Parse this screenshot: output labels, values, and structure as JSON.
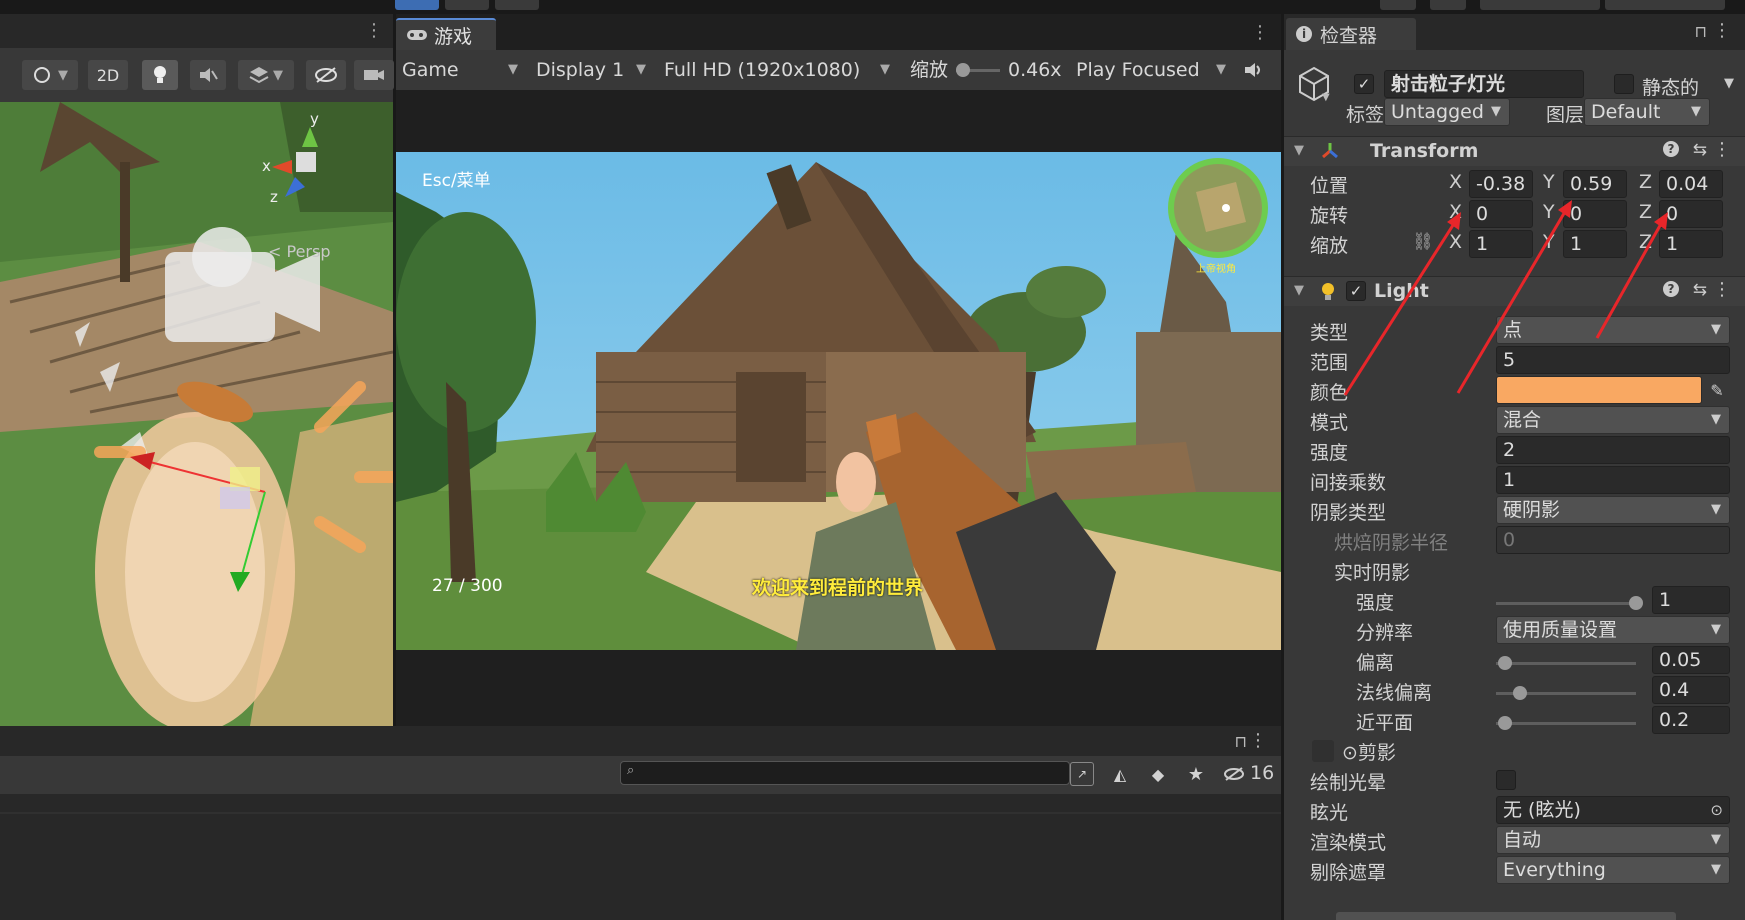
{
  "game_panel": {
    "tab_label": "游戏",
    "mode": "Game",
    "display": "Display 1",
    "resolution": "Full HD (1920x1080)",
    "scale_label": "缩放",
    "scale_value": "0.46x",
    "play_mode": "Play Focused"
  },
  "scene_panel": {
    "two_d_label": "2D",
    "persp_label": "< Persp",
    "axis_labels": [
      "y",
      "x",
      "z"
    ]
  },
  "game_view": {
    "menu_hint": "Esc/菜单",
    "ammo": "27 / 300",
    "subtitle": "欢迎来到程前的世界",
    "minimap_label": "上帝视角"
  },
  "bottom_panel": {
    "hidden_count": "16"
  },
  "inspector": {
    "tab_label": "检查器",
    "object_name": "射击粒子灯光",
    "static_label": "静态的",
    "tag_label": "标签",
    "tag_value": "Untagged",
    "layer_label": "图层",
    "layer_value": "Default",
    "transform": {
      "title": "Transform",
      "position_label": "位置",
      "rotation_label": "旋转",
      "scale_label": "缩放",
      "position": {
        "x": "-0.38",
        "y": "0.59",
        "z": "0.04"
      },
      "rotation": {
        "x": "0",
        "y": "0",
        "z": "0"
      },
      "scale": {
        "x": "1",
        "y": "1",
        "z": "1"
      }
    },
    "light": {
      "title": "Light",
      "type_label": "类型",
      "type_value": "点",
      "range_label": "范围",
      "range_value": "5",
      "color_label": "颜色",
      "color_value": "#f9a862",
      "mode_label": "模式",
      "mode_value": "混合",
      "intensity_label": "强度",
      "intensity_value": "2",
      "indirect_label": "间接乘数",
      "indirect_value": "1",
      "shadow_type_label": "阴影类型",
      "shadow_type_value": "硬阴影",
      "baked_radius_label": "烘焙阴影半径",
      "baked_radius_value": "0",
      "realtime_label": "实时阴影",
      "rt_strength_label": "强度",
      "rt_strength_value": "1",
      "resolution_label": "分辨率",
      "resolution_value": "使用质量设置",
      "bias_label": "偏离",
      "bias_value": "0.05",
      "normal_bias_label": "法线偏离",
      "normal_bias_value": "0.4",
      "near_plane_label": "近平面",
      "near_plane_value": "0.2",
      "cookie_label": "剪影",
      "draw_halo_label": "绘制光晕",
      "flare_label": "眩光",
      "flare_value": "无 (眩光)",
      "render_mode_label": "渲染模式",
      "render_mode_value": "自动",
      "culling_label": "剔除遮罩",
      "culling_value": "Everything"
    }
  }
}
